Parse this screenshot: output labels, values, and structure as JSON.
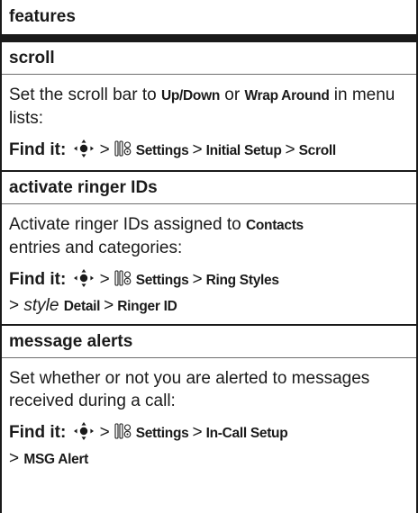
{
  "header": {
    "title": "features"
  },
  "sections": [
    {
      "title": "scroll",
      "desc_pre": "Set the scroll bar to ",
      "desc_opt1": "Up/Down",
      "desc_mid": " or ",
      "desc_opt2": "Wrap Around",
      "desc_post": " in menu lists:",
      "findit_label": "Find it:",
      "path": [
        "Settings",
        "Initial Setup",
        "Scroll"
      ]
    },
    {
      "title": "activate ringer IDs",
      "desc_pre": "Activate ringer IDs assigned to ",
      "desc_opt1": "Contacts",
      "desc_post": " entries and categories:",
      "findit_label": "Find it:",
      "path": [
        "Settings",
        "Ring Styles"
      ],
      "path_line2_italic": "style",
      "path_line2_rest": "Detail",
      "path_line2_last": "Ringer ID"
    },
    {
      "title": "message alerts",
      "desc": "Set whether or not you are alerted to messages received during a call:",
      "findit_label": "Find it:",
      "path": [
        "Settings",
        "In-Call Setup"
      ],
      "path_line2_last": "MSG Alert"
    }
  ],
  "separator": ">",
  "icons": {
    "nav": "nav-key-icon",
    "settings": "settings-icon"
  }
}
